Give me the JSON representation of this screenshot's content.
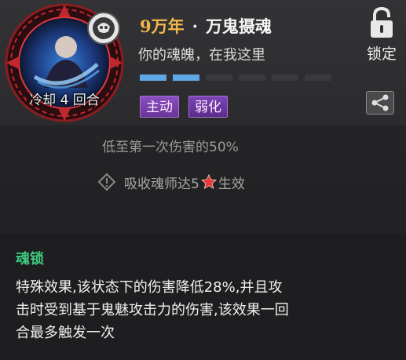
{
  "skill": {
    "cooldown": "冷却 4 回合",
    "title_years": "9万年",
    "title_separator": "·",
    "title_name": "万鬼摄魂",
    "subtitle": "你的魂魄，在我这里",
    "bars_total": 6,
    "bars_filled": 2,
    "bar_color": "#5ea8e6",
    "tags": [
      "主动",
      "弱化"
    ]
  },
  "actions": {
    "lock_label": "锁定",
    "lock_icon": "padlock-icon",
    "share_icon": "share-icon"
  },
  "effect": {
    "partial_line": "低至第一次伤害的50%",
    "condition_prefix": "吸收魂师达5",
    "condition_suffix": "生效"
  },
  "sub_effect": {
    "name": "魂锁",
    "name_color": "#3ec97e",
    "description_line1": "特殊效果,该状态下的伤害降低28%,并且攻",
    "description_line2": "击时受到基于鬼魅攻击力的伤害,该效果一回",
    "description_line3": "合最多触发一次"
  }
}
